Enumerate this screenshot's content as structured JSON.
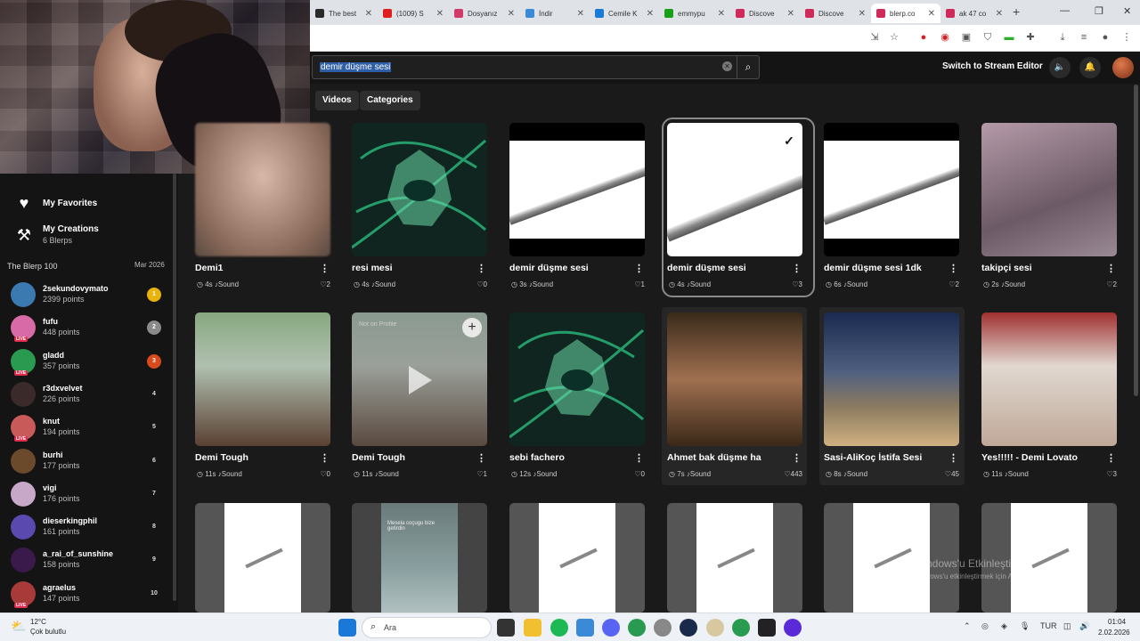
{
  "browser": {
    "tabs": [
      {
        "label": "The best",
        "color": "#2a2a2a"
      },
      {
        "label": "(1009) S",
        "color": "#e02020"
      },
      {
        "label": "Dosyanız",
        "color": "#d23a6a"
      },
      {
        "label": "İndir",
        "color": "#3a8ad8"
      },
      {
        "label": "Cemile K",
        "color": "#1a7ad8"
      },
      {
        "label": "emmypu",
        "color": "#18a018"
      },
      {
        "label": "Discove",
        "color": "#d02a5a"
      },
      {
        "label": "Discove",
        "color": "#d02a5a"
      },
      {
        "label": "blerp.co",
        "color": "#d02a5a"
      },
      {
        "label": "ak 47 co",
        "color": "#d02a5a"
      }
    ],
    "new_tab": "+",
    "win_min": "—",
    "win_max": "❐",
    "win_close": "✕"
  },
  "header": {
    "search_query": "demir düşme sesi",
    "stream_editor": "Switch to Stream Editor"
  },
  "nav_tabs": {
    "videos": "Videos",
    "categories": "Categories"
  },
  "sidebar": {
    "favorites": "My Favorites",
    "creations": "My Creations",
    "creations_count": "6 Blerps",
    "blerp100": "The Blerp 100",
    "blerp100_date": "Mar 2026",
    "leaderboard": [
      {
        "name": "2sekundovymato",
        "points": "2399 points",
        "rank": "1",
        "live": false,
        "color": "#3a7ab0",
        "badge": "#e8b30a"
      },
      {
        "name": "fufu",
        "points": "448 points",
        "rank": "2",
        "live": true,
        "color": "#d86aa8",
        "badge": "#8a8a8a"
      },
      {
        "name": "gladd",
        "points": "357 points",
        "rank": "3",
        "live": true,
        "color": "#2a9a50",
        "badge": "#d84a1a"
      },
      {
        "name": "r3dxvelvet",
        "points": "226 points",
        "rank": "4",
        "live": false,
        "color": "#3a2a2a",
        "badge": ""
      },
      {
        "name": "knut",
        "points": "194 points",
        "rank": "5",
        "live": true,
        "color": "#c85a5a",
        "badge": ""
      },
      {
        "name": "burhi",
        "points": "177 points",
        "rank": "6",
        "live": false,
        "color": "#6a4a2a",
        "badge": ""
      },
      {
        "name": "vigi",
        "points": "176 points",
        "rank": "7",
        "live": false,
        "color": "#c8a8c8",
        "badge": ""
      },
      {
        "name": "dieserkingphil",
        "points": "161 points",
        "rank": "8",
        "live": false,
        "color": "#5a4ab0",
        "badge": ""
      },
      {
        "name": "a_rai_of_sunshine",
        "points": "158 points",
        "rank": "9",
        "live": false,
        "color": "#3a1a4a",
        "badge": ""
      },
      {
        "name": "agraelus",
        "points": "147 points",
        "rank": "10",
        "live": true,
        "color": "#a83a3a",
        "badge": ""
      }
    ]
  },
  "grid": {
    "row1": [
      {
        "title": "Demi1",
        "duration": "4s",
        "type": "Sound",
        "likes": "2",
        "style": "blur"
      },
      {
        "title": "resi mesi",
        "duration": "4s",
        "type": "Sound",
        "likes": "0",
        "style": "green"
      },
      {
        "title": "demir düşme sesi",
        "duration": "3s",
        "type": "Sound",
        "likes": "1",
        "style": "pipe"
      },
      {
        "title": "demir düşme sesi",
        "duration": "4s",
        "type": "Sound",
        "likes": "3",
        "style": "pipesel"
      },
      {
        "title": "demir düşme sesi 1dk",
        "duration": "6s",
        "type": "Sound",
        "likes": "2",
        "style": "pipe"
      },
      {
        "title": "takipçi sesi",
        "duration": "2s",
        "type": "Sound",
        "likes": "2",
        "style": "girl"
      }
    ],
    "row2": [
      {
        "title": "Demi Tough",
        "duration": "11s",
        "type": "Sound",
        "likes": "0",
        "style": "man1"
      },
      {
        "title": "Demi Tough",
        "duration": "11s",
        "type": "Sound",
        "likes": "1",
        "style": "man2"
      },
      {
        "title": "sebi fachero",
        "duration": "12s",
        "type": "Sound",
        "likes": "0",
        "style": "green"
      },
      {
        "title": "Ahmet bak düşme ha",
        "duration": "7s",
        "type": "Sound",
        "likes": "443",
        "style": "ahmet"
      },
      {
        "title": "Sasi-AliKoç İstifa Sesi",
        "duration": "8s",
        "type": "Sound",
        "likes": "45",
        "style": "sasi"
      },
      {
        "title": "Yes!!!!! - Demi Lovato",
        "duration": "11s",
        "type": "Sound",
        "likes": "3",
        "style": "demi"
      }
    ],
    "not_on_profile": "Not on Profile",
    "cake_caption": "Mesela coçugu bize getirdin"
  },
  "watermark": {
    "line1": "Windows'u Etkinleştir",
    "line2": "Windows'u etkinleştirmek için Ayarlar'a gidin."
  },
  "taskbar": {
    "temp": "12°C",
    "weather": "Çok bulutlu",
    "search": "Ara",
    "lang": "TUR",
    "time": "01:04",
    "date": "2.02.2026"
  }
}
